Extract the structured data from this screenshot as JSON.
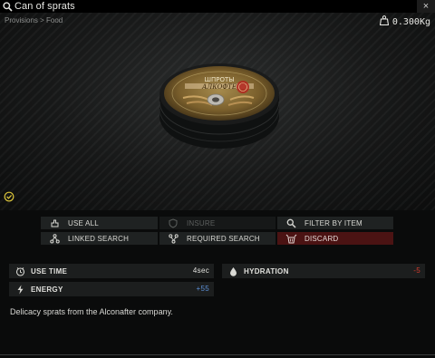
{
  "window": {
    "title": "Can of sprats",
    "close_label": "×"
  },
  "preview": {
    "breadcrumb": "Provisions > Food",
    "weight": "0.300Kg",
    "can_lid_text_line1": "ШПРОТЫ",
    "can_lid_text_line2": "АЛКОФТЕ"
  },
  "actions": [
    {
      "label": "USE ALL",
      "icon": "use-icon",
      "enabled": true
    },
    {
      "label": "INSURE",
      "icon": "shield-icon",
      "enabled": false
    },
    {
      "label": "FILTER BY ITEM",
      "icon": "search-icon",
      "enabled": true
    },
    {
      "label": "LINKED SEARCH",
      "icon": "link-search-icon",
      "enabled": true
    },
    {
      "label": "REQUIRED SEARCH",
      "icon": "required-search-icon",
      "enabled": true
    },
    {
      "label": "DISCARD",
      "icon": "discard-icon",
      "enabled": true,
      "style": "danger"
    }
  ],
  "stats": {
    "use_time": {
      "label": "USE TIME",
      "value": "4sec",
      "icon": "clock-icon"
    },
    "hydration": {
      "label": "HYDRATION",
      "value": "-5",
      "icon": "water-drop-icon",
      "value_color": "#d33a2c"
    },
    "energy": {
      "label": "ENERGY",
      "value": "+55",
      "icon": "lightning-icon",
      "value_color": "#5b8fd6"
    }
  },
  "description": "Delicacy sprats from the Alconafter company."
}
